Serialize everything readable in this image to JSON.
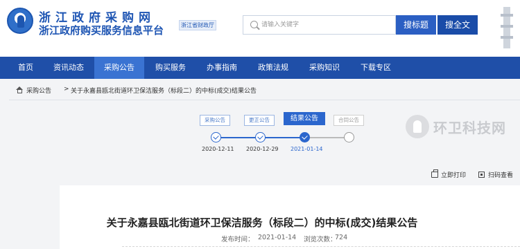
{
  "header": {
    "site_title": "浙江政府采购网",
    "site_subtitle": "浙江政府购买服务信息平台",
    "finance_tag": "浙江省财政厅",
    "search_placeholder": "请输入关键字",
    "search_bid_label": "搜标题",
    "search_all_label": "搜全文"
  },
  "nav": {
    "items": [
      "首页",
      "资讯动态",
      "采购公告",
      "购买服务",
      "办事指南",
      "政策法规",
      "采购知识",
      "下载专区"
    ],
    "active": "采购公告"
  },
  "breadcrumb": {
    "link": "采购公告",
    "separator": ">",
    "current": "关于永嘉县瓯北街道环卫保洁服务（标段二）的中标(成交)结果公告"
  },
  "timeline": {
    "steps": [
      {
        "label": "采购公告",
        "date": "2020-12-11",
        "status": "done"
      },
      {
        "label": "更正公告",
        "date": "2020-12-29",
        "status": "done"
      },
      {
        "label": "结果公告",
        "date": "2021-01-14",
        "status": "current"
      },
      {
        "label": "合同公告",
        "date": "",
        "status": "pending"
      }
    ]
  },
  "watermark": {
    "text": "环卫科技网"
  },
  "actions": {
    "print_label": "立即打印",
    "qr_label": "扫码查看"
  },
  "article": {
    "title": "关于永嘉县瓯北街道环卫保洁服务（标段二）的中标(成交)结果公告",
    "publish_label": "发布时间：",
    "publish_date": "2021-01-14",
    "views_label": "浏览次数：",
    "views_count": "724"
  },
  "colors": {
    "brand_blue": "#1f4fa8",
    "active_nav": "#3a73d2",
    "step_blue": "#2b66cd"
  }
}
